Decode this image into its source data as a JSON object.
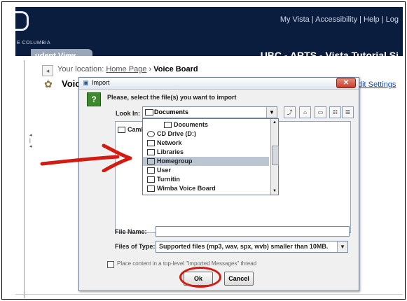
{
  "header": {
    "links": "My Vista | Accessibility | Help | Log",
    "brand": "E COLUMBIA",
    "tab": "udent View",
    "app_title": "UBC - ARTS - Vista Tutorial Si"
  },
  "breadcrumb": {
    "prefix": "Your location:",
    "home": "Home Page",
    "sep": "›",
    "current": "Voice Board"
  },
  "page": {
    "title": "Voic",
    "edit_link": "dit Settings"
  },
  "dialog": {
    "title": "Import",
    "close": "✕",
    "prompt": "Please, select the file(s) you want to import",
    "look_in_label": "Look In:",
    "look_in_value": "Documents",
    "area_item": "Camb",
    "dropdown_items": [
      "Documents",
      "CD Drive (D:)",
      "Network",
      "Libraries",
      "Homegroup",
      "User",
      "Turnitin",
      "Wimba Voice Board"
    ],
    "selected_item": "Homegroup",
    "file_name_label": "File Name:",
    "file_name_value": "",
    "files_of_type_label": "Files of Type:",
    "files_of_type_value": "Supported files (mp3, wav, spx, wvb) smaller than 10MB.",
    "checkbox_label": "Place content in a top-level \"Imported Messages\" thread",
    "ok": "Ok",
    "cancel": "Cancel"
  },
  "colors": {
    "header_bg": "#0b1d3e",
    "annotation_red": "#d21b12",
    "selection": "#bcc5d2"
  }
}
